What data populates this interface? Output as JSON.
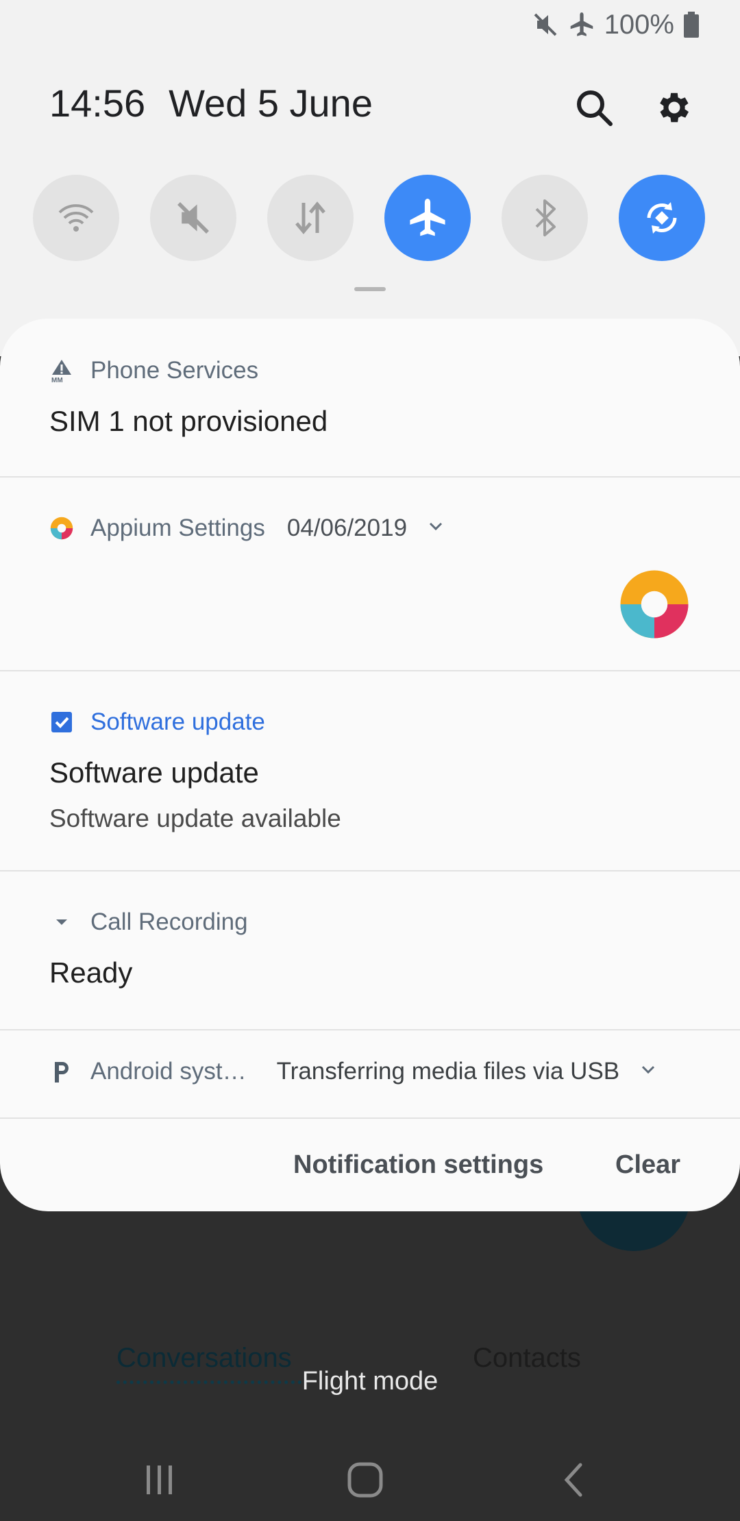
{
  "status_bar": {
    "battery": "100%",
    "icons": [
      "mute-icon",
      "airplane-icon",
      "battery-icon"
    ]
  },
  "header": {
    "time": "14:56",
    "date": "Wed 5 June"
  },
  "quick_tiles": [
    {
      "name": "wifi-tile",
      "icon": "wifi-icon",
      "active": false
    },
    {
      "name": "sound-tile",
      "icon": "mute-icon",
      "active": false
    },
    {
      "name": "mobile-data-tile",
      "icon": "data-arrows-icon",
      "active": false
    },
    {
      "name": "flight-mode-tile",
      "icon": "airplane-icon",
      "active": true
    },
    {
      "name": "bluetooth-tile",
      "icon": "bluetooth-icon",
      "active": false
    },
    {
      "name": "auto-rotate-tile",
      "icon": "rotate-icon",
      "active": true
    }
  ],
  "notifications": {
    "phone_services": {
      "app": "Phone Services",
      "title": "SIM 1 not provisioned"
    },
    "appium": {
      "app": "Appium Settings",
      "time": "04/06/2019"
    },
    "software_update": {
      "app": "Software update",
      "title": "Software update",
      "text": "Software update available"
    },
    "call_recording": {
      "app": "Call Recording",
      "title": "Ready"
    },
    "android_system": {
      "app": "Android syst…",
      "text": "Transferring media files via USB"
    }
  },
  "footer": {
    "settings_label": "Notification settings",
    "clear_label": "Clear"
  },
  "background": {
    "tab_conversations": "Conversations",
    "tab_contacts": "Contacts",
    "toast": "Flight mode"
  },
  "colors": {
    "accent": "#3d8af7",
    "panel": "#f2f2f2",
    "card": "#fafafa",
    "link": "#2f6fdd"
  }
}
